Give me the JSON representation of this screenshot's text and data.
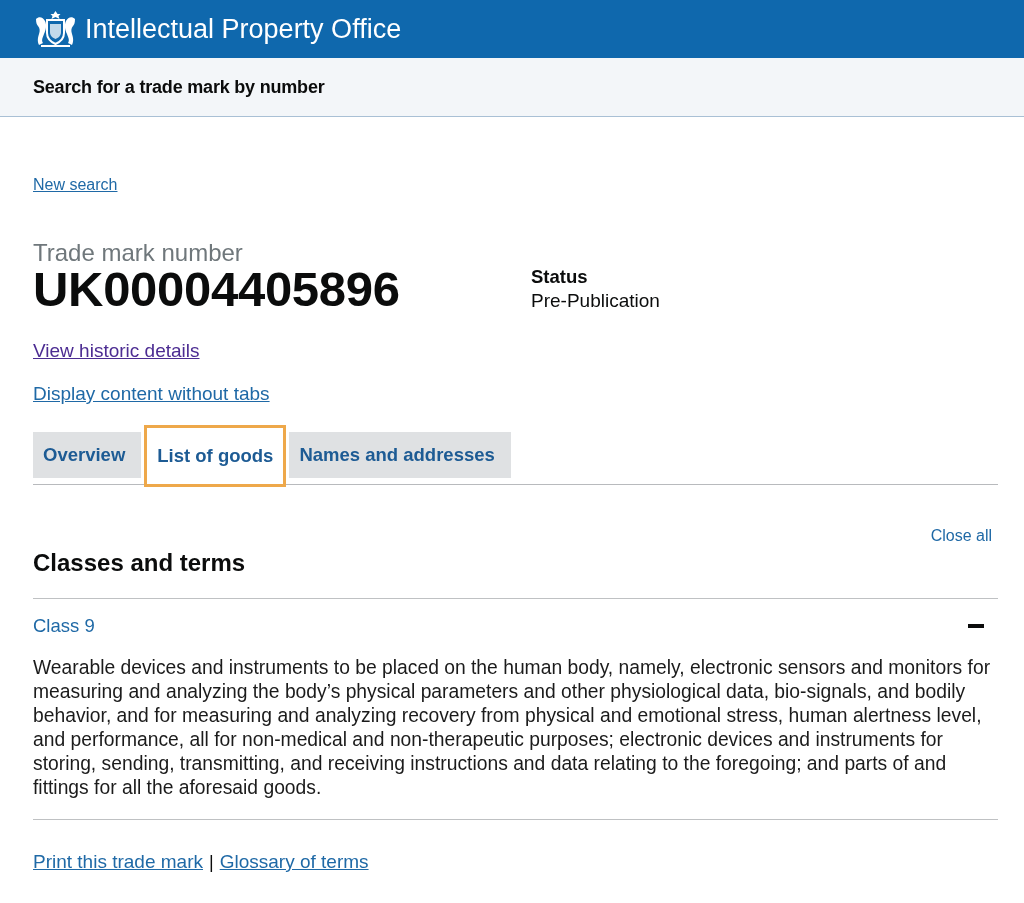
{
  "header": {
    "title": "Intellectual Property Office"
  },
  "service_bar": {
    "title": "Search for a trade mark by number"
  },
  "back_link": {
    "label": "New search",
    "visited": false
  },
  "trade_mark": {
    "caption": "Trade mark number",
    "number": "UK00004405896",
    "status_label": "Status",
    "status_value": "Pre-Publication"
  },
  "links": [
    {
      "label": "View historic details",
      "visited": true
    },
    {
      "label": "Display content without tabs",
      "visited": false
    }
  ],
  "tabs": [
    {
      "label": "Overview",
      "selected": false
    },
    {
      "label": "List of goods",
      "selected": true
    },
    {
      "label": "Names and addresses",
      "selected": false
    }
  ],
  "panel": {
    "close_all": "Close all",
    "heading": "Classes and terms",
    "sections": [
      {
        "title": "Class 9",
        "expanded": true,
        "text": "Wearable devices and instruments to be placed on the human body, namely, electronic sensors and monitors for measuring and analyzing the body’s physical parameters and other physiological data, bio-signals, and bodily behavior, and for measuring and analyzing recovery from physical and emotional stress, human alertness level, and performance, all for non-medical and non-therapeutic purposes; electronic devices and instruments for storing, sending, transmitting, and receiving instructions and data relating to the foregoing; and parts of and fittings for all the aforesaid goods."
      }
    ]
  },
  "footer": {
    "links": [
      {
        "label": "Print this trade mark"
      },
      {
        "label": "Glossary of terms"
      }
    ],
    "separator": "|"
  }
}
